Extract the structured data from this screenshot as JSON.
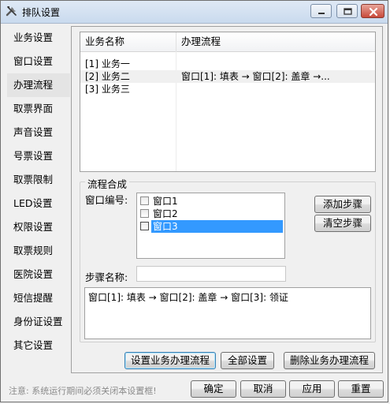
{
  "window": {
    "title": "排队设置",
    "title_icon": "tools-icon"
  },
  "sidebar": {
    "items": [
      {
        "label": "业务设置"
      },
      {
        "label": "窗口设置"
      },
      {
        "label": "办理流程"
      },
      {
        "label": "取票界面"
      },
      {
        "label": "声音设置"
      },
      {
        "label": "号票设置"
      },
      {
        "label": "取票限制"
      },
      {
        "label": "LED设置"
      },
      {
        "label": "权限设置"
      },
      {
        "label": "取票规则"
      },
      {
        "label": "医院设置"
      },
      {
        "label": "短信提醒"
      },
      {
        "label": "身份证设置"
      },
      {
        "label": "其它设置"
      }
    ],
    "active_index": 2
  },
  "business_list": {
    "columns": [
      "业务名称",
      "办理流程"
    ],
    "rows": [
      {
        "name": "[1] 业务一",
        "flow": ""
      },
      {
        "name": "[2] 业务二",
        "flow": "窗口[1]: 填表 → 窗口[2]: 盖章 →..."
      },
      {
        "name": "[3] 业务三",
        "flow": ""
      }
    ],
    "selected_index": 1
  },
  "flow_group": {
    "title": "流程合成",
    "window_no_label": "窗口编号:",
    "windows": [
      {
        "label": "窗口1",
        "checked": false
      },
      {
        "label": "窗口2",
        "checked": false
      },
      {
        "label": "窗口3",
        "checked": false
      }
    ],
    "selected_window_index": 2,
    "add_step_label": "添加步骤",
    "clear_steps_label": "清空步骤",
    "step_name_label": "步骤名称:",
    "step_name_value": "",
    "flow_text": "窗口[1]: 填表 → 窗口[2]: 盖章 → 窗口[3]: 领证"
  },
  "actions": {
    "set_flow_label": "设置业务办理流程",
    "all_settings_label": "全部设置",
    "delete_flow_label": "删除业务办理流程"
  },
  "footer": {
    "note": "注意: 系统运行期间必须关闭本设置框!",
    "ok_label": "确定",
    "cancel_label": "取消",
    "apply_label": "应用",
    "reset_label": "重置"
  }
}
